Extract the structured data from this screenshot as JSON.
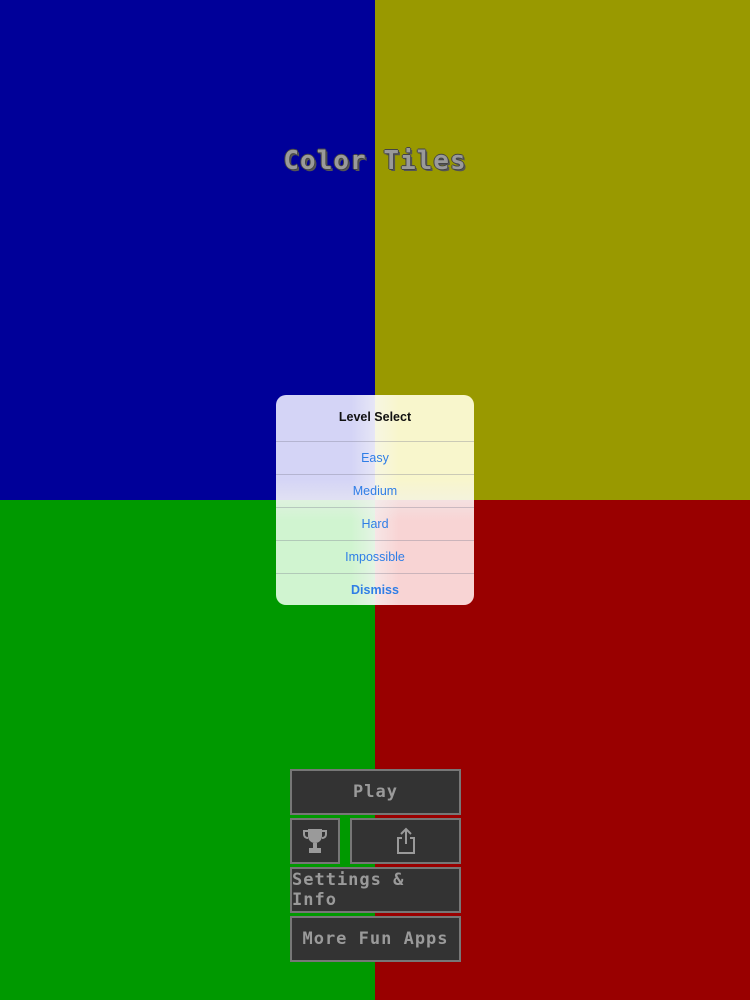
{
  "game": {
    "title": "Color Tiles",
    "tile_colors": {
      "top_left": "#000099",
      "top_right": "#999900",
      "bottom_left": "#009900",
      "bottom_right": "#990000"
    }
  },
  "level_select": {
    "title": "Level Select",
    "options": [
      {
        "label": "Easy"
      },
      {
        "label": "Medium"
      },
      {
        "label": "Hard"
      },
      {
        "label": "Impossible"
      }
    ],
    "dismiss_label": "Dismiss",
    "option_color": "#2f7ee6"
  },
  "menu": {
    "play_label": "Play",
    "trophy_icon": "trophy-icon",
    "share_icon": "share-icon",
    "settings_label": "Settings & Info",
    "more_label": "More Fun Apps",
    "button_bg": "#333333",
    "button_border": "#777777"
  }
}
